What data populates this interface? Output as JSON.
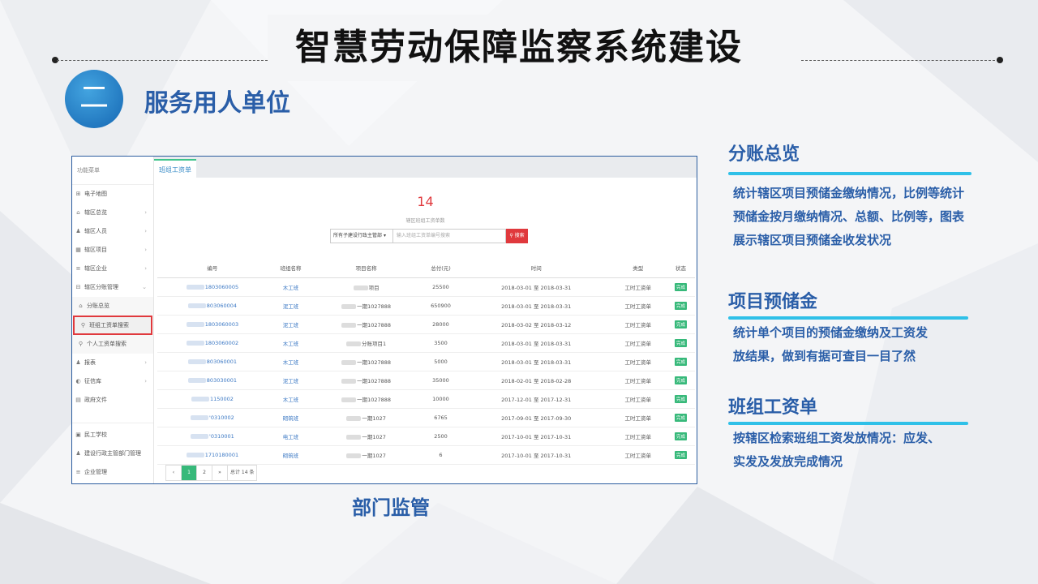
{
  "header": {
    "title": "智慧劳动保障监察系统建设",
    "section_number": "二",
    "section_title": "服务用人单位"
  },
  "screenshot": {
    "sidebar": {
      "heading": "功能菜单",
      "items": [
        {
          "label": "电子地图",
          "icon": "map-icon",
          "glyph": "⊞",
          "arrow": ""
        },
        {
          "label": "辖区总览",
          "icon": "home-icon",
          "glyph": "⌂",
          "arrow": "›"
        },
        {
          "label": "辖区人员",
          "icon": "people-icon",
          "glyph": "♟",
          "arrow": "›"
        },
        {
          "label": "辖区项目",
          "icon": "grid-icon",
          "glyph": "▦",
          "arrow": "›"
        },
        {
          "label": "辖区企业",
          "icon": "list-icon",
          "glyph": "≡",
          "arrow": "›"
        },
        {
          "label": "辖区分账管理",
          "icon": "ledger-icon",
          "glyph": "⊟",
          "arrow": "⌄"
        }
      ],
      "sub_items": [
        {
          "label": "分账总览",
          "icon": "home-icon",
          "glyph": "⌂"
        },
        {
          "label": "班组工资单搜索",
          "icon": "search-icon",
          "glyph": "⚲"
        },
        {
          "label": "个人工资单搜索",
          "icon": "search-icon",
          "glyph": "⚲"
        }
      ],
      "items_after": [
        {
          "label": "报表",
          "icon": "user-icon",
          "glyph": "♟",
          "arrow": "›"
        },
        {
          "label": "征信库",
          "icon": "shield-icon",
          "glyph": "◐",
          "arrow": "›"
        },
        {
          "label": "政府文件",
          "icon": "file-icon",
          "glyph": "▤",
          "arrow": ""
        }
      ],
      "items_bottom": [
        {
          "label": "民工学校",
          "icon": "school-icon",
          "glyph": "▣",
          "arrow": ""
        },
        {
          "label": "建设行政主管部门管理",
          "icon": "user-icon",
          "glyph": "♟",
          "arrow": ""
        },
        {
          "label": "企业管理",
          "icon": "list-icon",
          "glyph": "≡",
          "arrow": ""
        }
      ]
    },
    "tab": "班组工资单",
    "count": "14",
    "count_label": "辖区班组工资单数",
    "search": {
      "select_value": "所有子建设行政主管部",
      "placeholder": "输入班组工资单编号搜索",
      "button": "搜索"
    },
    "columns": [
      "编号",
      "班组名称",
      "项目名称",
      "总付(元)",
      "时间",
      "类型",
      "状态"
    ],
    "rows": [
      {
        "id": "1803060005",
        "team": "木工班",
        "project": "项目",
        "total": "25500",
        "time": "2018-03-01 至 2018-03-31",
        "type": "工时工资单",
        "status": "完成"
      },
      {
        "id": "803060004",
        "team": "泥工班",
        "project": "一期1027888",
        "total": "650900",
        "time": "2018-03-01 至 2018-03-31",
        "type": "工时工资单",
        "status": "完成"
      },
      {
        "id": "1803060003",
        "team": "泥工班",
        "project": "一期1027888",
        "total": "28000",
        "time": "2018-03-02 至 2018-03-12",
        "type": "工时工资单",
        "status": "完成"
      },
      {
        "id": "1803060002",
        "team": "木工班",
        "project": "分账项目1",
        "total": "3500",
        "time": "2018-03-01 至 2018-03-31",
        "type": "工时工资单",
        "status": "完成"
      },
      {
        "id": "803060001",
        "team": "木工班",
        "project": "一期1027888",
        "total": "5000",
        "time": "2018-03-01 至 2018-03-31",
        "type": "工时工资单",
        "status": "完成"
      },
      {
        "id": "803030001",
        "team": "泥工班",
        "project": "一期1027888",
        "total": "35000",
        "time": "2018-02-01 至 2018-02-28",
        "type": "工时工资单",
        "status": "完成"
      },
      {
        "id": "1150002",
        "team": "木工班",
        "project": "一期1027888",
        "total": "10000",
        "time": "2017-12-01 至 2017-12-31",
        "type": "工时工资单",
        "status": "完成"
      },
      {
        "id": "'0310002",
        "team": "砌筑班",
        "project": "一期1027",
        "total": "6765",
        "time": "2017-09-01 至 2017-09-30",
        "type": "工时工资单",
        "status": "完成"
      },
      {
        "id": "'0310001",
        "team": "电工班",
        "project": "一期1027",
        "total": "2500",
        "time": "2017-10-01 至 2017-10-31",
        "type": "工时工资单",
        "status": "完成"
      },
      {
        "id": "1710180001",
        "team": "砌筑班",
        "project": "一期1027",
        "total": "6",
        "time": "2017-10-01 至 2017-10-31",
        "type": "工时工资单",
        "status": "完成"
      }
    ],
    "pager": {
      "prev": "‹",
      "pages": [
        "1",
        "2"
      ],
      "next": "»",
      "total": "总计 14 条"
    }
  },
  "caption": "部门监管",
  "features": [
    {
      "title": "分账总览",
      "text": [
        "统计辖区项目预储金缴纳情况，比例等统计",
        "预储金按月缴纳情况、总额、比例等，图表",
        "展示辖区项目预储金收发状况"
      ]
    },
    {
      "title": "项目预储金",
      "text": [
        "统计单个项目的预储金缴纳及工资发",
        "放结果，做到有据可查目一目了然"
      ]
    },
    {
      "title": "班组工资单",
      "text": [
        "按辖区检索班组工资发放情况：应发、",
        "实发及发放完成情况"
      ]
    }
  ],
  "colors": {
    "accent": "#2a5ea8",
    "highlight": "#2fc0e8",
    "danger": "#e0393d",
    "success": "#37b97a"
  }
}
